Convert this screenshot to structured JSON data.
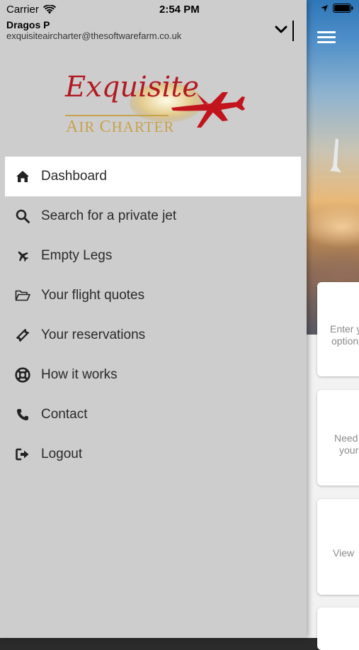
{
  "status_bar": {
    "carrier": "Carrier",
    "time": "2:54 PM",
    "wifi_icon": "wifi-icon",
    "location_icon": "location-arrow-icon",
    "battery_icon": "battery-icon"
  },
  "account": {
    "name": "Dragos P",
    "email": "exquisiteaircharter@thesoftwarefarm.co.uk",
    "toggle_icon": "chevron-down-icon"
  },
  "logo": {
    "script_text": "Exquisite",
    "subtitle_first_a": "A",
    "subtitle_ir": "IR",
    "subtitle_c": "C",
    "subtitle_harter": "HARTER",
    "plane_icon": "jet-plane-icon",
    "colors": {
      "red": "#b21a22",
      "gold": "#c9a24c"
    }
  },
  "menu": {
    "items": [
      {
        "label": "Dashboard",
        "icon": "home-icon",
        "active": true
      },
      {
        "label": "Search for a private jet",
        "icon": "search-icon",
        "active": false
      },
      {
        "label": "Empty Legs",
        "icon": "plane-icon",
        "active": false
      },
      {
        "label": "Your flight quotes",
        "icon": "folder-open-icon",
        "active": false
      },
      {
        "label": "Your reservations",
        "icon": "ticket-icon",
        "active": false
      },
      {
        "label": "How it works",
        "icon": "life-ring-icon",
        "active": false
      },
      {
        "label": "Contact",
        "icon": "phone-icon",
        "active": false
      },
      {
        "label": "Logout",
        "icon": "sign-out-icon",
        "active": false
      }
    ]
  },
  "background": {
    "menu_icon": "hamburger-menu-icon",
    "cards": [
      {
        "line1": "Enter y",
        "line2": "option"
      },
      {
        "line1": "Need",
        "line2": "your"
      },
      {
        "line1": "View"
      },
      {
        "line1": ""
      }
    ]
  },
  "theme": {
    "drawer_bg": "#cdcdcd",
    "active_item_bg": "#ffffff",
    "text": "#2a2a2a"
  }
}
